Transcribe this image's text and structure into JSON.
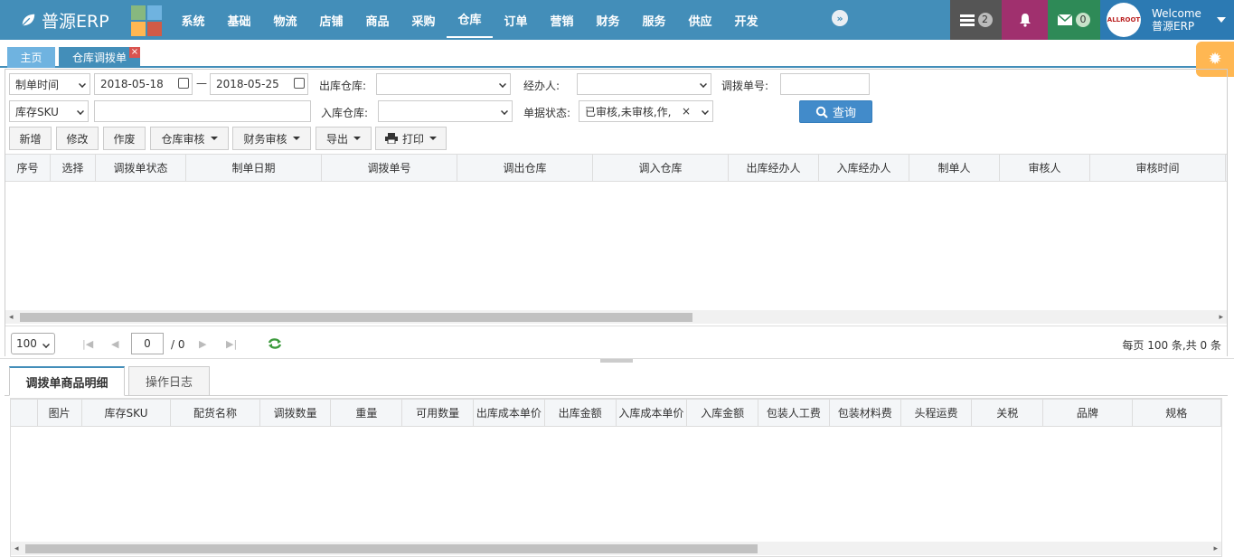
{
  "app": {
    "title": "普源ERP"
  },
  "nav": [
    "系统",
    "基础",
    "物流",
    "店铺",
    "商品",
    "采购",
    "仓库",
    "订单",
    "营销",
    "财务",
    "服务",
    "供应",
    "开发"
  ],
  "nav_active": "仓库",
  "topbar": {
    "tasks_count": "2",
    "messages_count": "0",
    "welcome": "Welcome",
    "user": "普源ERP",
    "avatar_text": "ALLROOT"
  },
  "tabs": {
    "home": "主页",
    "current": "仓库调拨单"
  },
  "filters": {
    "date_type": "制单时间",
    "date_from": "2018-05-18",
    "date_sep": "—",
    "date_to": "2018-05-25",
    "out_wh_label": "出库仓库:",
    "handler_label": "经办人:",
    "transfer_no_label": "调拨单号:",
    "sku_type": "库存SKU",
    "in_wh_label": "入库仓库:",
    "status_label": "单据状态:",
    "status_value": "已审核,未审核,作,"
  },
  "toolbar": {
    "add": "新增",
    "edit": "修改",
    "void": "作废",
    "wh_audit": "仓库审核",
    "fin_audit": "财务审核",
    "export": "导出",
    "print": "打印",
    "query": "查询"
  },
  "main_grid": {
    "columns": [
      "序号",
      "选择",
      "调拨单状态",
      "制单日期",
      "调拨单号",
      "调出仓库",
      "调入仓库",
      "出库经办人",
      "入库经办人",
      "制单人",
      "审核人",
      "审核时间"
    ]
  },
  "pager": {
    "page_size": "100",
    "page": "0",
    "total_pages": "/ 0",
    "summary": "每页 100 条,共 0 条"
  },
  "lower_tabs": [
    "调拨单商品明细",
    "操作日志"
  ],
  "detail_grid": {
    "columns": [
      "图片",
      "库存SKU",
      "配货名称",
      "调拨数量",
      "重量",
      "可用数量",
      "出库成本单价",
      "出库金额",
      "入库成本单价",
      "入库金额",
      "包装人工费",
      "包装材料费",
      "头程运费",
      "关税",
      "品牌",
      "规格"
    ]
  },
  "colors": {
    "topbar": "#438eb9",
    "accent": "#428bca",
    "tasks_bg": "#555555",
    "bell_bg": "#a0306e",
    "mail_bg": "#2e8a57",
    "gear_bg": "#ffb752"
  }
}
